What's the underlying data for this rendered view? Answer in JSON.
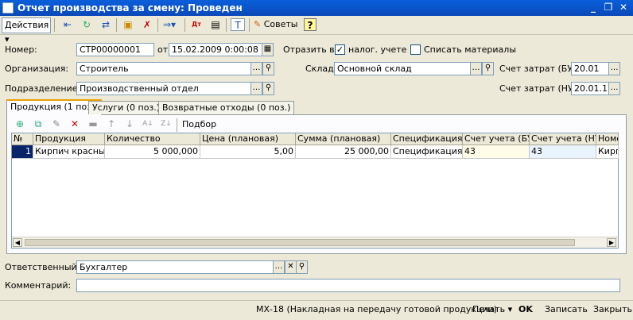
{
  "window": {
    "title": "Отчет производства за смену: Проведен",
    "controls": [
      "_",
      "❐",
      "✕"
    ]
  },
  "toolbar": {
    "actions_label": "Действия",
    "tips_label": "Советы",
    "help_label": "?"
  },
  "form": {
    "number_label": "Номер:",
    "number_value": "СТР00000001",
    "date_label": "от:",
    "date_value": "15.02.2009  0:00:08",
    "reflect_label": "Отразить в:",
    "tax_checkbox_label": "налог. учете",
    "tax_checked": true,
    "writeoff_label": "Списать материалы",
    "writeoff_checked": false,
    "org_label": "Организация:",
    "org_value": "Строитель",
    "warehouse_label": "Склад:",
    "warehouse_value": "Основной склад",
    "cost_bu_label": "Счет затрат (БУ):",
    "cost_bu_value": "20.01",
    "division_label": "Подразделение:",
    "division_value": "Производственный отдел",
    "cost_nu_label": "Счет затрат (НУ):",
    "cost_nu_value": "20.01.1"
  },
  "tabs": [
    {
      "label": "Продукция (1 поз.)",
      "active": true
    },
    {
      "label": "Услуги (0 поз.)",
      "active": false
    },
    {
      "label": "Возвратные отходы (0 поз.)",
      "active": false
    }
  ],
  "grid_toolbar": {
    "selection_label": "Подбор"
  },
  "table": {
    "columns": [
      "№",
      "Продукция",
      "Количество",
      "Цена (плановая)",
      "Сумма (плановая)",
      "Спецификация",
      "Счет учета (БУ)",
      "Счет учета (НУ)",
      "Номе"
    ],
    "rows": [
      [
        "1",
        "Кирпич красный",
        "5 000,000",
        "5,00",
        "25 000,00",
        "Спецификация...",
        "43",
        "43",
        "Кирпи"
      ]
    ]
  },
  "bottom": {
    "responsible_label": "Ответственный:",
    "responsible_value": "Бухгалтер",
    "comment_label": "Комментарий:",
    "comment_value": ""
  },
  "status": {
    "print_form": "МХ-18 (Накладная на передачу готовой продукции)",
    "print_label": "Печать",
    "ok_label": "OK",
    "save_label": "Записать",
    "close_label": "Закрыть"
  },
  "colors": {
    "title_bar": "#0A49B9",
    "window_bg": "#ECE9D8",
    "active_tab_accent": "#E8A202",
    "selected_cell": "#0A246A"
  }
}
